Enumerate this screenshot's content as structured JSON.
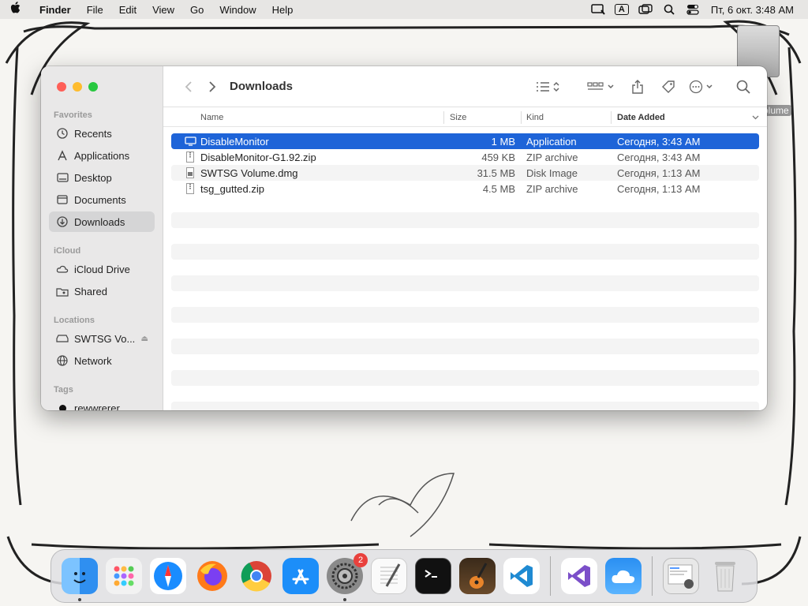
{
  "menubar": {
    "apple": "",
    "app_name": "Finder",
    "items": [
      "File",
      "Edit",
      "View",
      "Go",
      "Window",
      "Help"
    ],
    "clock": "Пт, 6 окт.  3:48 AM",
    "input_indicator": "A"
  },
  "desktop": {
    "volume_label": "olume"
  },
  "window": {
    "title": "Downloads",
    "sidebar": {
      "favorites_label": "Favorites",
      "favorites": [
        {
          "label": "Recents",
          "icon": "clock-icon"
        },
        {
          "label": "Applications",
          "icon": "applications-icon"
        },
        {
          "label": "Desktop",
          "icon": "desktop-icon"
        },
        {
          "label": "Documents",
          "icon": "document-icon"
        },
        {
          "label": "Downloads",
          "icon": "download-icon"
        }
      ],
      "icloud_label": "iCloud",
      "icloud": [
        {
          "label": "iCloud Drive",
          "icon": "cloud-icon"
        },
        {
          "label": "Shared",
          "icon": "shared-folder-icon"
        }
      ],
      "locations_label": "Locations",
      "locations": [
        {
          "label": "SWTSG Vo...",
          "icon": "drive-icon"
        },
        {
          "label": "Network",
          "icon": "globe-icon"
        }
      ],
      "tags_label": "Tags",
      "tags": [
        {
          "label": "rewwrerer",
          "color": "#111111"
        }
      ]
    },
    "columns": {
      "name": "Name",
      "size": "Size",
      "kind": "Kind",
      "date_added": "Date Added"
    },
    "files": [
      {
        "name": "DisableMonitor",
        "size": "1 MB",
        "kind": "Application",
        "date": "Сегодня, 3:43 AM",
        "icon": "application-icon"
      },
      {
        "name": "DisableMonitor-G1.92.zip",
        "size": "459 KB",
        "kind": "ZIP archive",
        "date": "Сегодня, 3:43 AM",
        "icon": "zip-icon"
      },
      {
        "name": "SWTSG Volume.dmg",
        "size": "31.5 MB",
        "kind": "Disk Image",
        "date": "Сегодня, 1:13 AM",
        "icon": "disk-image-icon"
      },
      {
        "name": "tsg_gutted.zip",
        "size": "4.5 MB",
        "kind": "ZIP archive",
        "date": "Сегодня, 1:13 AM",
        "icon": "zip-icon"
      }
    ]
  },
  "dock": {
    "apps": [
      {
        "name": "finder-icon",
        "color": "#2f8ff0"
      },
      {
        "name": "launchpad-icon",
        "color": "#f2f2f2"
      },
      {
        "name": "safari-icon",
        "color": "#1a8cff"
      },
      {
        "name": "firefox-icon",
        "color": "#ff7a1a"
      },
      {
        "name": "chrome-icon",
        "color": "#ffffff"
      },
      {
        "name": "app-store-icon",
        "color": "#1c8ef9"
      },
      {
        "name": "system-settings-icon",
        "color": "#8a8a8a",
        "badge": "2"
      },
      {
        "name": "textedit-icon",
        "color": "#fafafa"
      },
      {
        "name": "terminal-icon",
        "color": "#111111"
      },
      {
        "name": "garageband-icon",
        "color": "#3a2a1a"
      },
      {
        "name": "vscode-icon",
        "color": "#ffffff"
      },
      {
        "name": "visual-studio-icon",
        "color": "#ffffff"
      },
      {
        "name": "weather-icon",
        "color": "#2a8ff2"
      },
      {
        "name": "downloads-stack-icon",
        "color": "#e8e8e8"
      },
      {
        "name": "trash-icon",
        "color": "#d8d8d8"
      }
    ]
  }
}
